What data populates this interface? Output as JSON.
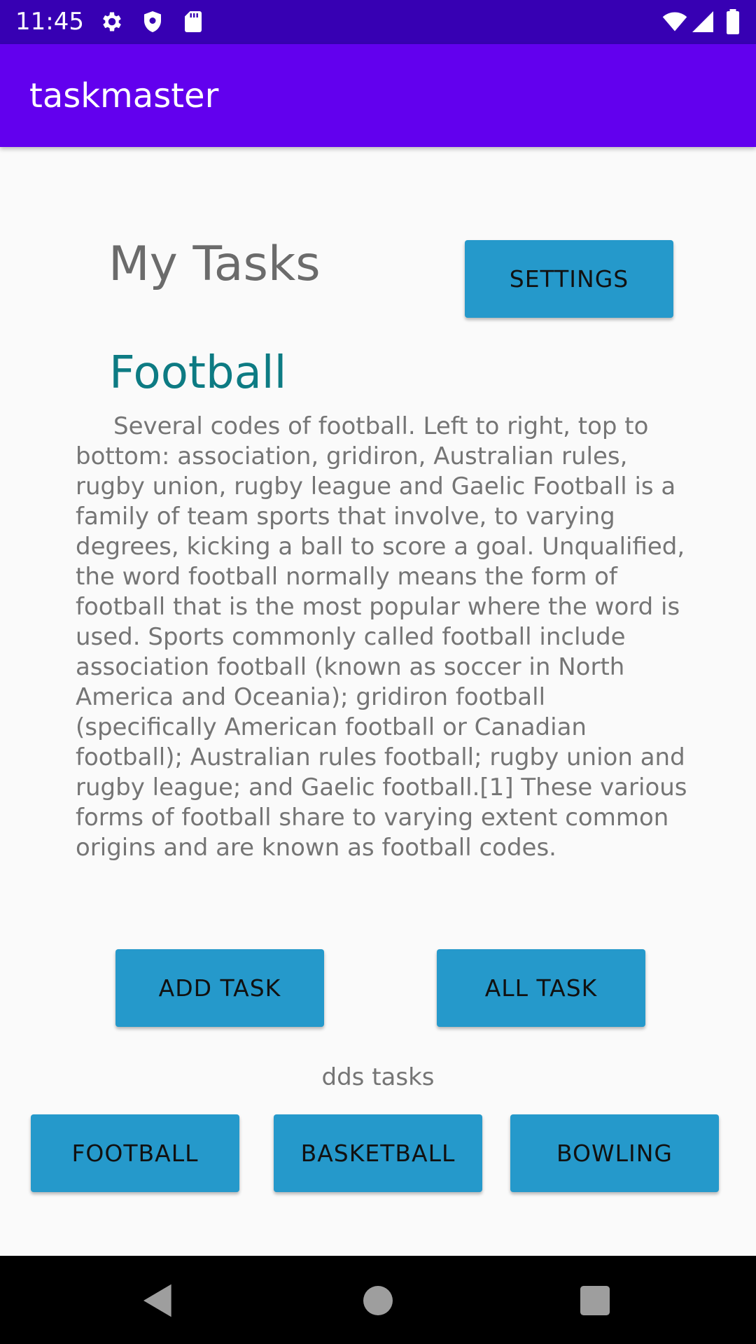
{
  "status_bar": {
    "time": "11:45",
    "icons": [
      "gear-icon",
      "shield-icon",
      "sd-card-icon",
      "wifi-icon",
      "signal-icon",
      "battery-icon"
    ]
  },
  "app_bar": {
    "title": "taskmaster",
    "color": "#6200ee"
  },
  "header": {
    "title": "My Tasks",
    "settings_label": "SETTINGS"
  },
  "task": {
    "title": "Football",
    "body": "Several codes of football. Left to right, top to bottom: association, gridiron, Australian rules, rugby union, rugby league and Gaelic Football is a family of team sports that involve, to varying degrees, kicking a ball to score a goal. Unqualified, the word football normally means the form of football that is the most popular where the word is used. Sports commonly called football include association football (known as soccer in North America and Oceania); gridiron football (specifically American football or Canadian football); Australian rules football; rugby union and rugby league; and Gaelic football.[1] These various forms of football share to varying extent common origins and are known as football codes."
  },
  "actions": {
    "add_task_label": "ADD TASK",
    "all_task_label": "ALL TASK"
  },
  "tasks_section": {
    "label": "dds tasks",
    "buttons": [
      "FOOTBALL",
      "BASKETBALL",
      "BOWLING"
    ]
  },
  "colors": {
    "status_bar": "#3700b3",
    "button": "#2599cb",
    "task_title": "#0d7b83"
  },
  "nav_bar": {
    "icons": [
      "back-icon",
      "home-icon",
      "recents-icon"
    ]
  }
}
